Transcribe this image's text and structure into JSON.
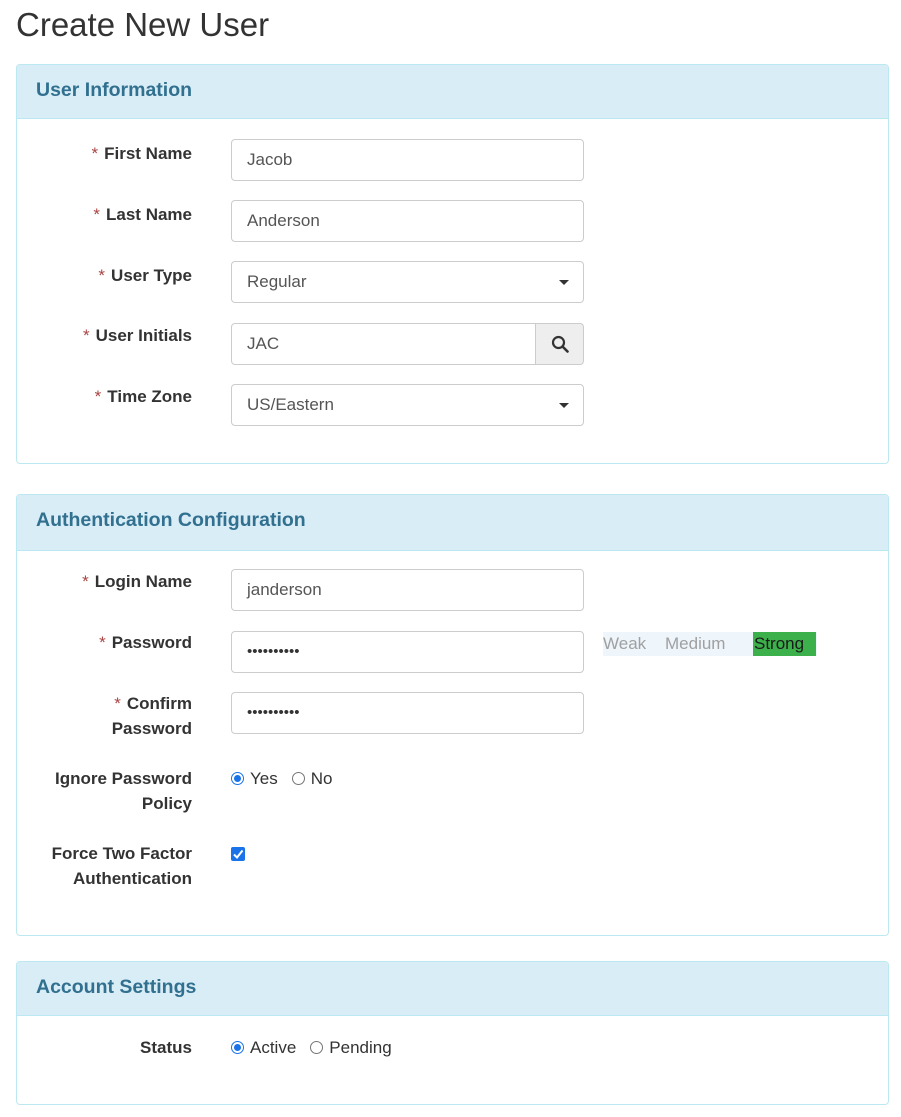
{
  "page": {
    "title": "Create New User"
  },
  "required_marker": "*",
  "user_info": {
    "heading": "User Information",
    "first_name": {
      "label": "First Name",
      "value": "Jacob"
    },
    "last_name": {
      "label": "Last Name",
      "value": "Anderson"
    },
    "user_type": {
      "label": "User Type",
      "value": "Regular"
    },
    "user_initials": {
      "label": "User Initials",
      "value": "JAC",
      "button_icon": "search-icon"
    },
    "time_zone": {
      "label": "Time Zone",
      "value": "US/Eastern"
    }
  },
  "auth": {
    "heading": "Authentication Configuration",
    "login_name": {
      "label": "Login Name",
      "value": "janderson"
    },
    "password": {
      "label": "Password",
      "value": "••••••••••"
    },
    "strength": {
      "weak": "Weak",
      "medium": "Medium",
      "strong": "Strong",
      "current": "Strong",
      "strong_color": "#3cb04a"
    },
    "confirm_password": {
      "label_line1": "Confirm",
      "label_line2": "Password",
      "value": "••••••••••"
    },
    "ignore_policy": {
      "label_line1": "Ignore Password",
      "label_line2": "Policy",
      "options": [
        "Yes",
        "No"
      ],
      "selected": "Yes"
    },
    "force_2fa": {
      "label_line1": "Force Two Factor",
      "label_line2": "Authentication",
      "checked": true
    }
  },
  "account": {
    "heading": "Account Settings",
    "status": {
      "label": "Status",
      "options": [
        "Active",
        "Pending"
      ],
      "selected": "Active"
    }
  },
  "colors": {
    "panel_heading_bg": "#d9edf7",
    "panel_heading_text": "#31708f",
    "panel_border": "#bce8f1",
    "required": "#a94442",
    "control_accent": "#1a73e8"
  }
}
